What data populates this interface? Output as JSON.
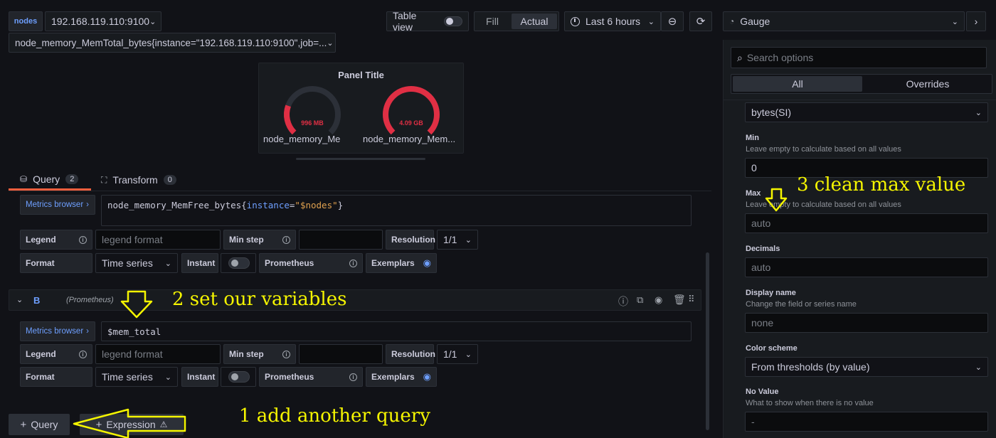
{
  "toolbar": {
    "var_label": "nodes",
    "var_value": "192.168.119.110:9100",
    "series_select": "node_memory_MemTotal_bytes{instance=\"192.168.119.110:9100\",job=...",
    "table_view": "Table view",
    "fill": "Fill",
    "actual": "Actual",
    "time_range": "Last 6 hours",
    "viz": "Gauge"
  },
  "panel": {
    "title": "Panel Title",
    "gauges": [
      {
        "value": "996 MB",
        "label": "node_memory_Mem...",
        "fraction": 0.24
      },
      {
        "value": "4.09 GB",
        "label": "node_memory_Mem...",
        "fraction": 1.0
      }
    ],
    "gauge_color": "#e02f44"
  },
  "tabs": {
    "query": "Query",
    "query_count": "2",
    "transform": "Transform",
    "transform_count": "0"
  },
  "queryA": {
    "metrics_browser": "Metrics browser",
    "expr_prefix": "node_memory_MemFree_bytes{",
    "expr_key": "instance",
    "expr_eq": "=",
    "expr_val": "\"$nodes\"",
    "expr_suffix": "}"
  },
  "queryB": {
    "letter": "B",
    "datasource": "(Prometheus)",
    "metrics_browser": "Metrics browser",
    "expr": "$mem_total"
  },
  "options_row": {
    "legend": "Legend",
    "legend_placeholder": "legend format",
    "min_step": "Min step",
    "resolution": "Resolution",
    "resolution_value": "1/1",
    "format": "Format",
    "format_value": "Time series",
    "instant": "Instant",
    "prometheus": "Prometheus",
    "exemplars": "Exemplars"
  },
  "bottom": {
    "add_query": "Query",
    "expression": "Expression"
  },
  "options_pane": {
    "search_placeholder": "Search options",
    "tab_all": "All",
    "tab_overrides": "Overrides",
    "unit_value": "bytes(SI)",
    "min_label": "Min",
    "min_desc": "Leave empty to calculate based on all values",
    "min_value": "0",
    "max_label": "Max",
    "max_desc": "Leave empty to calculate based on all values",
    "max_placeholder": "auto",
    "decimals_label": "Decimals",
    "decimals_placeholder": "auto",
    "display_name_label": "Display name",
    "display_name_desc": "Change the field or series name",
    "display_name_placeholder": "none",
    "color_scheme_label": "Color scheme",
    "color_scheme_value": "From thresholds (by value)",
    "no_value_label": "No Value",
    "no_value_desc": "What to show when there is no value",
    "no_value_placeholder": "-"
  },
  "annotations": {
    "a1": "1 add another query",
    "a2": "2  set our variables",
    "a3": "3 clean max value",
    "color": "#f5f500"
  }
}
